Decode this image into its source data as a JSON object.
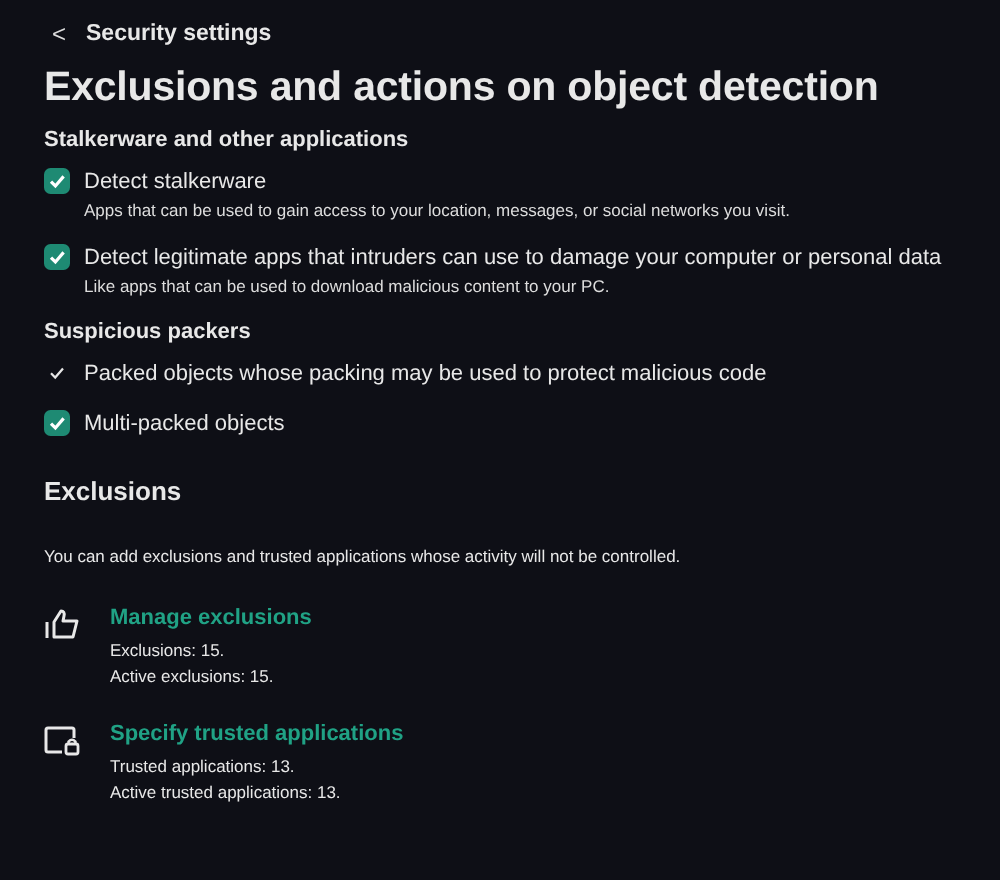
{
  "back": {
    "icon": "<",
    "label": "Security settings"
  },
  "title": "Exclusions and actions on object detection",
  "sections": [
    {
      "heading": "Stalkerware and other applications",
      "options": [
        {
          "kind": "checkbox",
          "checked": true,
          "label": "Detect stalkerware",
          "description": "Apps that can be used to gain access to your location, messages, or social networks you visit."
        },
        {
          "kind": "checkbox",
          "checked": true,
          "label": "Detect legitimate apps that intruders can use to damage your computer or personal data",
          "description": "Like apps that can be used to download malicious content to your PC."
        }
      ]
    },
    {
      "heading": "Suspicious packers",
      "options": [
        {
          "kind": "tick",
          "checked": true,
          "label": "Packed objects whose packing may be used to protect malicious code"
        },
        {
          "kind": "checkbox",
          "checked": true,
          "label": "Multi-packed objects"
        }
      ]
    }
  ],
  "exclusions": {
    "heading": "Exclusions",
    "text": "You can add exclusions and trusted applications whose activity will not be controlled.",
    "links": [
      {
        "kind": "thumb",
        "label": "Manage exclusions",
        "details": [
          "Exclusions: 15.",
          "Active exclusions: 15."
        ]
      },
      {
        "kind": "lock",
        "label": "Specify trusted applications",
        "details": [
          "Trusted applications: 13.",
          "Active trusted applications: 13."
        ]
      }
    ]
  }
}
